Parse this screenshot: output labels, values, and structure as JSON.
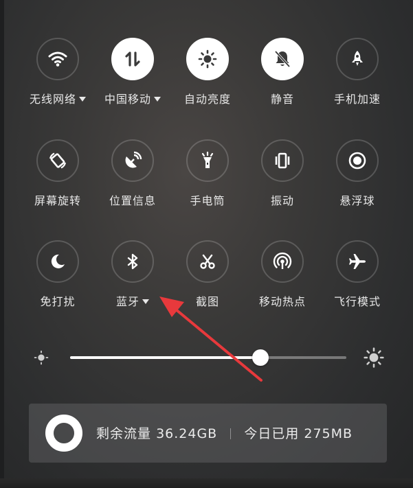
{
  "tiles": [
    {
      "label": "无线网络",
      "icon": "wifi-icon",
      "on": false,
      "caret": true
    },
    {
      "label": "中国移动",
      "icon": "mobile-data-icon",
      "on": true,
      "caret": true
    },
    {
      "label": "自动亮度",
      "icon": "brightness-auto-icon",
      "on": true,
      "caret": false
    },
    {
      "label": "静音",
      "icon": "mute-bell-icon",
      "on": true,
      "caret": false
    },
    {
      "label": "手机加速",
      "icon": "rocket-icon",
      "on": false,
      "caret": false
    },
    {
      "label": "屏幕旋转",
      "icon": "rotate-icon",
      "on": false,
      "caret": false
    },
    {
      "label": "位置信息",
      "icon": "location-icon",
      "on": false,
      "caret": false
    },
    {
      "label": "手电筒",
      "icon": "flashlight-icon",
      "on": false,
      "caret": false
    },
    {
      "label": "振动",
      "icon": "vibrate-icon",
      "on": false,
      "caret": false
    },
    {
      "label": "悬浮球",
      "icon": "floating-ball-icon",
      "on": false,
      "caret": false
    },
    {
      "label": "免打扰",
      "icon": "moon-icon",
      "on": false,
      "caret": false
    },
    {
      "label": "蓝牙",
      "icon": "bluetooth-icon",
      "on": false,
      "caret": true
    },
    {
      "label": "截图",
      "icon": "scissors-icon",
      "on": false,
      "caret": false
    },
    {
      "label": "移动热点",
      "icon": "hotspot-icon",
      "on": false,
      "caret": false
    },
    {
      "label": "飞行模式",
      "icon": "airplane-icon",
      "on": false,
      "caret": false
    }
  ],
  "brightness": {
    "level_fraction": 0.69,
    "low_icon": "brightness-low-icon",
    "high_icon": "brightness-high-icon"
  },
  "data_usage": {
    "remaining_label": "剩余流量",
    "remaining_value": "36.24GB",
    "today_label": "今日已用",
    "today_value": "275MB",
    "ring_icon": "data-usage-ring-icon"
  },
  "annotation": {
    "arrow_color": "#e8393c",
    "points_to": "蓝牙"
  },
  "colors": {
    "active_circle": "#ffffff",
    "inactive_icon": "#ffffff",
    "active_icon": "#3a3a3a"
  }
}
